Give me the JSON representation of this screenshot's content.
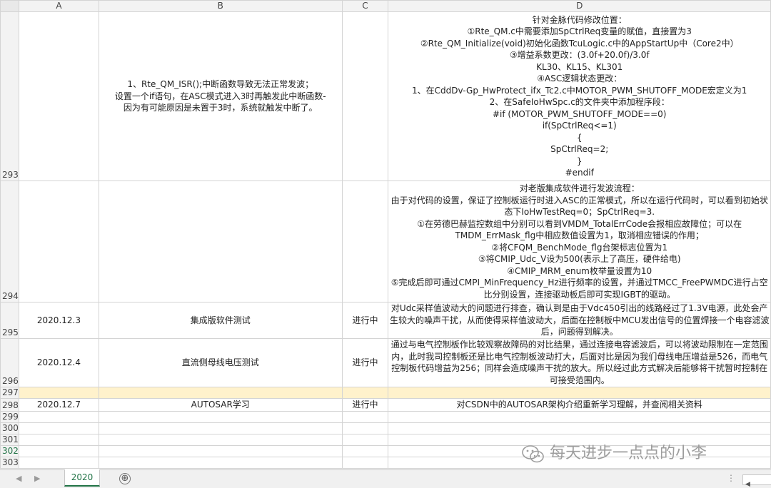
{
  "columns": [
    "A",
    "B",
    "C",
    "D"
  ],
  "rows": [
    {
      "num": "293",
      "a": "",
      "b": "1、Rte_QM_ISR();中断函数导致无法正常发波；\n设置一个if语句，在ASC模式进入3时再触发此中断函数-\n因为有可能原因是未置于3时，系统就触发中断了。",
      "c": "",
      "d": "针对金脉代码修改位置：\n①Rte_QM.c中需要添加SpCtrlReq变量的赋值，直接置为3\n②Rte_QM_Initialize(void)初始化函数TcuLogic.c中的AppStartUp中（Core2中）\n③增益系数更改：(3.0f+20.0f)/3.0f\nKL30、KL15、KL301\n④ASC逻辑状态更改：\n1、在CddDv-Gp_HwProtect_ifx_Tc2.c中MOTOR_PWM_SHUTOFF_MODE宏定义为1\n2、在SafeIoHwSpc.c的文件夹中添加程序段：\n#if (MOTOR_PWM_SHUTOFF_MODE==0)\nif(SpCtrlReq<=1)\n{\nSpCtrlReq=2;\n}\n#endif"
    },
    {
      "num": "294",
      "a": "",
      "b": "",
      "c": "",
      "d": "对老版集成软件进行发波流程：\n由于对代码的设置，保证了控制板运行时进入ASC的正常模式，所以在运行代码时，可以看到初始状态下IoHwTestReq=0；SpCtrlReq=3.\n①在劳德巴赫监控数组中分别可以看到VMDM_TotalErrCode会报相应故障位；可以在TMDM_ErrMask_flg中相应数值设置为1，取消相应错误的作用；\n②将CFQM_BenchMode_flg台架标志位置为1\n③将CMIP_Udc_V设为500(表示上了高压，硬件给电)\n④CMIP_MRM_enum枚举量设置为10\n⑤完成后即可通过CMPI_MinFrequency_Hz进行频率的设置，并通过TMCC_FreePWMDC进行占空比分别设置，连接驱动板后即可实现IGBT的驱动。"
    },
    {
      "num": "295",
      "a": "2020.12.3",
      "b": "集成版软件测试",
      "c": "进行中",
      "d": "对Udc采样值波动大的问题进行排查，确认到是由于Vdc450引出的线路经过了1.3V电源，此处会产生较大的噪声干扰，从而使得采样值波动大，后面在控制板中MCU发出信号的位置焊接一个电容滤波后，问题得到解决。"
    },
    {
      "num": "296",
      "a": "2020.12.4",
      "b": "直流侧母线电压测试",
      "c": "进行中",
      "d": "通过与电气控制板作比较观察故障码的对比结果，通过连接电容滤波后，可以将波动限制在一定范围内，此时我司控制板还是比电气控制板波动打大，后面对比是因为我们母线电压增益是526，而电气控制板代码增益为256；同样会造成噪声干扰的放大。所以经过此方式解决后能够将干扰暂时控制在可接受范围内。"
    },
    {
      "num": "297",
      "a": "",
      "b": "",
      "c": "",
      "d": ""
    },
    {
      "num": "298",
      "a": "2020.12.7",
      "b": "AUTOSAR学习",
      "c": "进行中",
      "d": "对CSDN中的AUTOSAR架构介绍重新学习理解，并查阅相关资料"
    },
    {
      "num": "299",
      "a": "",
      "b": "",
      "c": "",
      "d": ""
    },
    {
      "num": "300",
      "a": "",
      "b": "",
      "c": "",
      "d": ""
    },
    {
      "num": "301",
      "a": "",
      "b": "",
      "c": "",
      "d": ""
    },
    {
      "num": "302",
      "a": "",
      "b": "",
      "c": "",
      "d": ""
    },
    {
      "num": "303",
      "a": "",
      "b": "",
      "c": "",
      "d": ""
    }
  ],
  "tabs": {
    "active": "2020",
    "add_symbol": "⊕",
    "prev": "◀",
    "next": "▶",
    "more": "⋮",
    "scroll_left": "◀"
  },
  "watermark": {
    "text": "每天进步一点点的小李",
    "icon": "wechat-icon"
  },
  "colors": {
    "accent": "#217346",
    "highlight_row": "#fff2cc",
    "gridline": "#d4d4d4"
  }
}
